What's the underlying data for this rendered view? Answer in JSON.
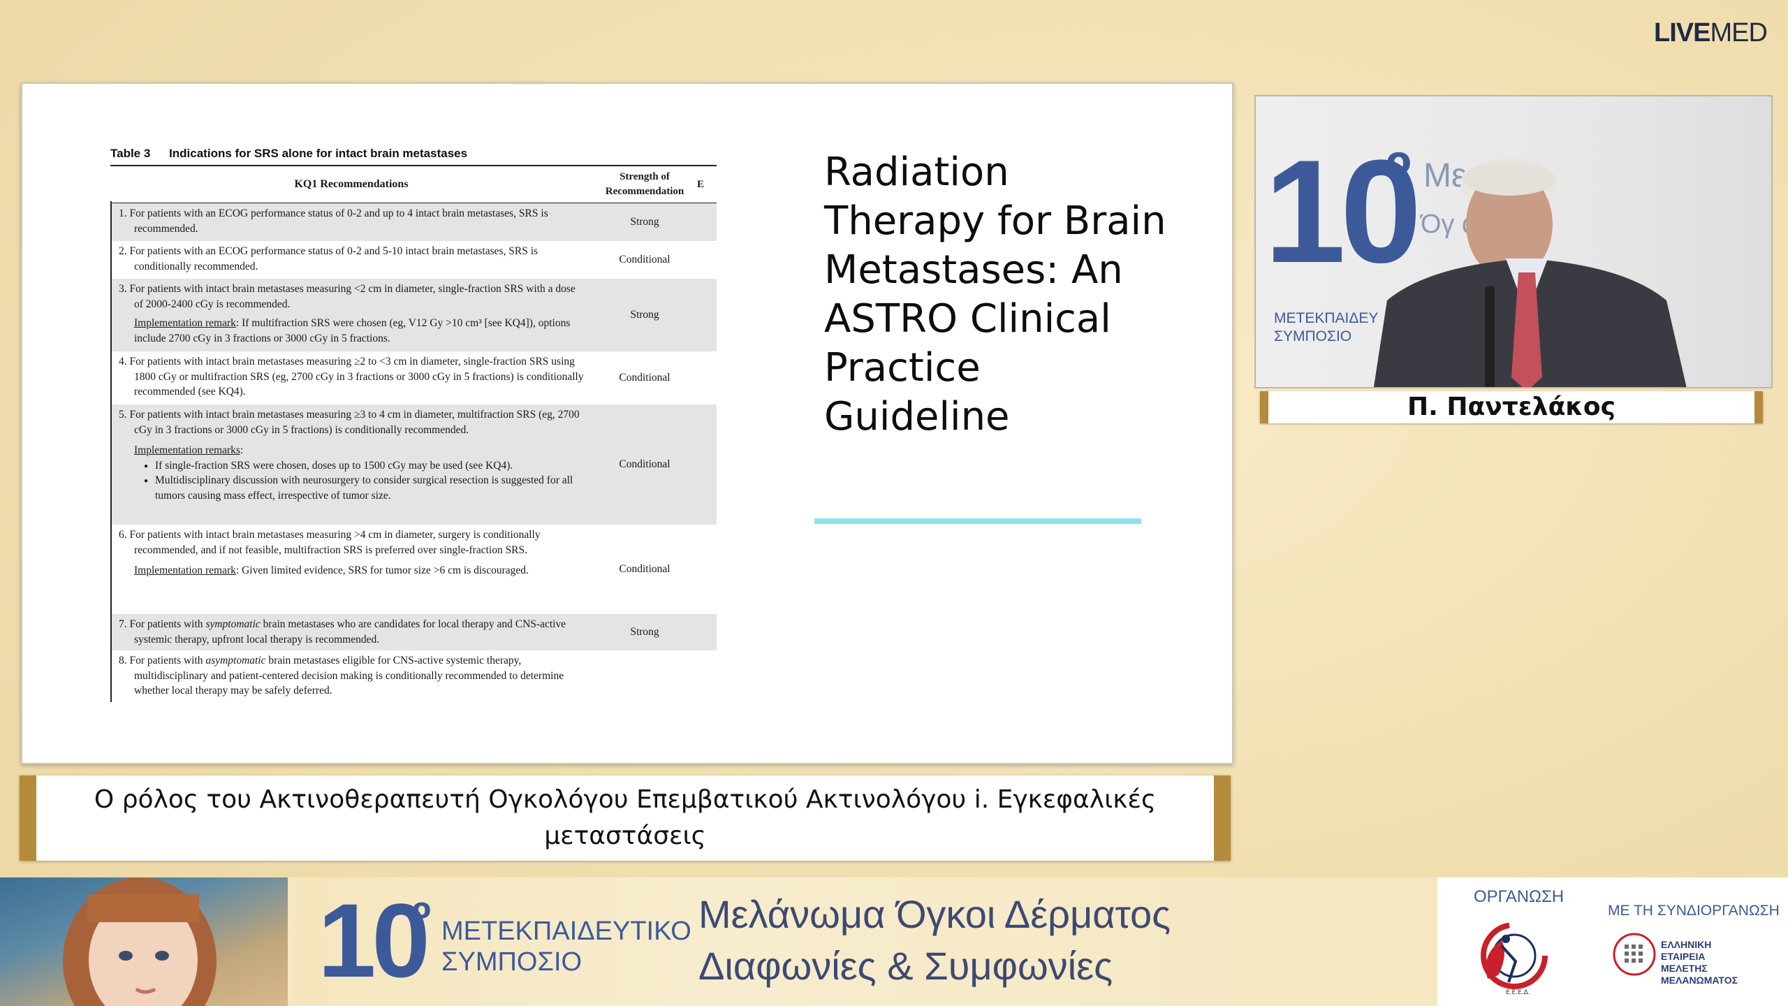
{
  "brand": {
    "bold": "LIVE",
    "light": "MED"
  },
  "slide": {
    "table_caption_number": "Table 3",
    "table_caption_text": "Indications for SRS alone for intact brain metastases",
    "table_header_recommendations": "KQ1 Recommendations",
    "table_header_strength_1": "Strength of",
    "table_header_strength_2": "Recommendation",
    "table_header_cut": "E",
    "rows": [
      {
        "text": "1. For patients with an ECOG performance status of 0-2 and up to 4 intact brain metastases, SRS is recommended.",
        "strength": "Strong"
      },
      {
        "text": "2. For patients with an ECOG performance status of 0-2 and 5-10 intact brain metastases, SRS is conditionally recommended.",
        "strength": "Conditional"
      },
      {
        "text": "3. For patients with intact brain metastases measuring <2 cm in diameter, single-fraction SRS with a dose of 2000-2400 cGy is recommended.",
        "impl_label": "Implementation remark",
        "impl_text": ": If multifraction SRS were chosen (eg, V12 Gy >10 cm³ [see KQ4]), options include 2700 cGy in 3 fractions or 3000 cGy in 5 fractions.",
        "strength": "Strong"
      },
      {
        "text": "4. For patients with intact brain metastases measuring ≥2 to <3 cm in diameter, single-fraction SRS using 1800 cGy or multifraction SRS (eg, 2700 cGy in 3 fractions or 3000 cGy in 5 fractions) is conditionally recommended (see KQ4).",
        "strength": "Conditional"
      },
      {
        "text": "5. For patients with intact brain metastases measuring ≥3 to 4 cm in diameter, multifraction SRS (eg, 2700 cGy in 3 fractions or 3000 cGy in 5 fractions) is conditionally recommended.",
        "impl_label": "Implementation remarks",
        "impl_text": ":",
        "bullets": [
          "If single-fraction SRS were chosen, doses up to 1500 cGy may be used (see KQ4).",
          "Multidisciplinary discussion with neurosurgery to consider surgical resection is suggested for all tumors causing mass effect, irrespective of tumor size."
        ],
        "strength": "Conditional"
      },
      {
        "text": "6. For patients with intact brain metastases measuring >4 cm in diameter, surgery is conditionally recommended, and if not feasible, multifraction SRS is preferred over single-fraction SRS.",
        "impl_label": "Implementation remark",
        "impl_text": ": Given limited evidence, SRS for tumor size >6 cm is discouraged.",
        "strength": "Conditional"
      },
      {
        "text_a": "7. For patients with ",
        "text_em": "symptomatic",
        "text_b": " brain metastases who are candidates for local therapy and CNS-active systemic therapy, upfront local therapy is recommended.",
        "strength": "Strong"
      },
      {
        "text_a": "8. For patients with ",
        "text_em": "asymptomatic",
        "text_b": " brain metastases eligible for CNS-active systemic therapy, multidisciplinary and patient-centered decision making is conditionally recommended to determine whether local therapy may be safely deferred.",
        "strength": ""
      }
    ],
    "title_lines": [
      "Radiation",
      "Therapy for Brain",
      "Metastases: An",
      "ASTRO Clinical",
      "Practice",
      "Guideline"
    ],
    "accent_color": "#8fe0ec"
  },
  "video": {
    "backdrop_number": "10",
    "backdrop_degree": "o",
    "backdrop_text1": "Με",
    "backdrop_text2": "Όγ  ατος",
    "backdrop_sub1": "ΜΕΤΕΚΠΑΙΔΕΥ",
    "backdrop_sub2": "ΣΥΜΠΟΣΙΟ"
  },
  "speaker_name": "Π. Παντελάκος",
  "lower_third": "Ο ρόλος του Ακτινοθεραπευτή Ογκολόγου Επεμβατικού Ακτινολόγου i. Εγκεφαλικές μεταστάσεις",
  "footer": {
    "number": "10",
    "degree": "o",
    "symposium_1": "ΜΕΤΕΚΠΑΙΔΕΥΤΙΚΟ",
    "symposium_2": "ΣΥΜΠΟΣΙΟ",
    "line1": "Μελάνωμα Όγκοι Δέρματος",
    "line2": "Διαφωνίες & Συμφωνίες",
    "org_label": "ΟΡΓΑΝΩΣΗ",
    "coorg_label": "ΜΕ ΤΗ ΣΥΝΔΙΟΡΓΑΝΩΣΗ",
    "coorg_lines": [
      "ΕΛΛΗΝΙΚΗ",
      "ΕΤΑΙΡΕΙΑ",
      "ΜΕΛΕΤΗΣ",
      "ΜΕΛΑΝΩΜΑΤΟΣ"
    ],
    "org_acronym": "Ε.Ε.Ε.Δ."
  },
  "colors": {
    "gold_frame": "#b48a3b",
    "brand_blue": "#3c5a9a"
  }
}
